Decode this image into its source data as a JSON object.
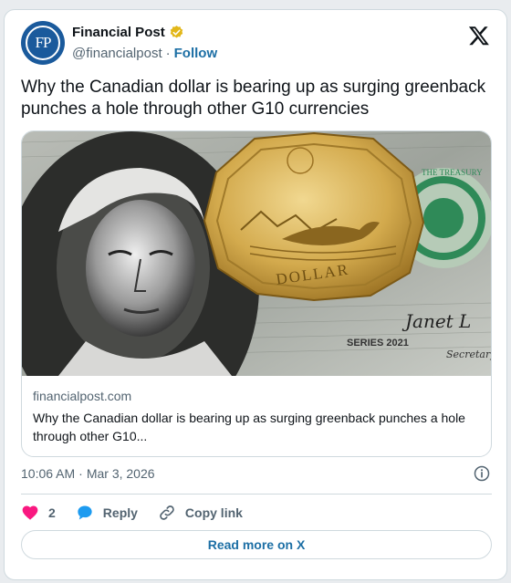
{
  "author": {
    "name": "Financial Post",
    "handle": "@financialpost",
    "separator": "·",
    "follow_label": "Follow",
    "avatar_text": "FP",
    "verified_icon": "verified-gold-badge-icon",
    "brand_color": "#1a5a9c"
  },
  "platform": {
    "logo_icon": "x-logo-icon"
  },
  "tweet": {
    "text": "Why the Canadian dollar is bearing up as surging greenback punches a hole through other G10 currencies"
  },
  "media": {
    "image_description": "Canadian one dollar loonie coin resting on a US one dollar bill",
    "coin_text": "DOLLAR",
    "bill_series": "SERIES 2021",
    "bill_signature": "Janet L",
    "bill_secretary": "Secretary",
    "bill_seal": "THE TREASURY"
  },
  "link_card": {
    "domain": "financialpost.com",
    "title": "Why the Canadian dollar is bearing up as surging greenback punches a hole through other G10..."
  },
  "meta": {
    "time": "10:06 AM",
    "separator": "·",
    "date": "Mar 3, 2026",
    "info_icon": "info-icon"
  },
  "actions": {
    "like_count": "2",
    "reply_label": "Reply",
    "copy_link_label": "Copy link",
    "like_color": "#f91880",
    "reply_color": "#1d9bf0"
  },
  "read_more_label": "Read more on X"
}
